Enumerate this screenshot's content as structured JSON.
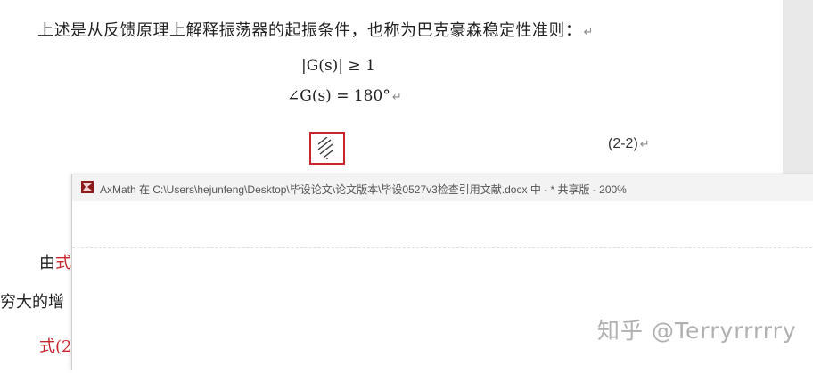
{
  "document": {
    "para1": "上述是从反馈原理上解释振荡器的起振条件，也称为巴克豪森稳定性准则：",
    "formula1": "|G(s)| ≥ 1",
    "formula2": "∠G(s) = 180°",
    "equation_number": "(2-2)",
    "paragraph_mark": "↵",
    "line_a_start": "由",
    "line_a_red": "式",
    "line_b": "穷大的增",
    "line_c_red": "式(2"
  },
  "axmath": {
    "title": "AxMath 在 C:\\Users\\hejunfeng\\Desktop\\毕设论文\\论文版本\\毕设0527v3检查引用文献.docx 中 - * 共享版 - 200%"
  },
  "watermark": "知乎 @Terryrrrrry",
  "colors": {
    "accent_red": "#c8252c",
    "titlebar": "#f3f3f3"
  }
}
